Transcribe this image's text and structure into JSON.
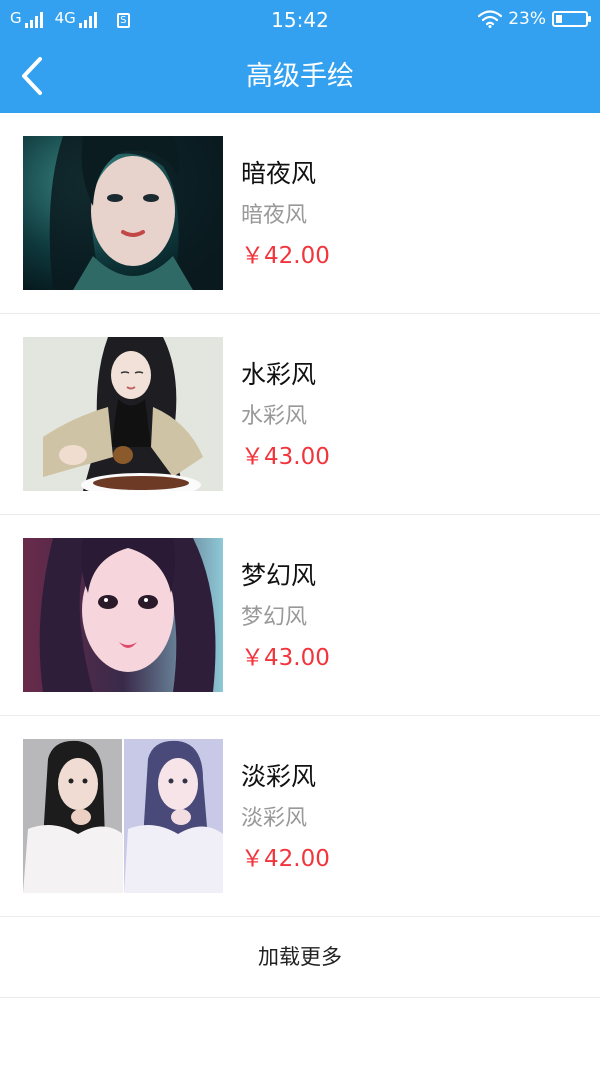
{
  "status_bar": {
    "carrier1": "G",
    "carrier2": "4G",
    "sim_label": "S",
    "time": "15:42",
    "battery_text": "23%",
    "battery_level": 0.23
  },
  "header": {
    "back_icon": "chevron-left-icon",
    "title": "高级手绘"
  },
  "items": [
    {
      "title": "暗夜风",
      "subtitle": "暗夜风",
      "price": "￥42.00"
    },
    {
      "title": "水彩风",
      "subtitle": "水彩风",
      "price": "￥43.00"
    },
    {
      "title": "梦幻风",
      "subtitle": "梦幻风",
      "price": "￥43.00"
    },
    {
      "title": "淡彩风",
      "subtitle": "淡彩风",
      "price": "￥42.00"
    }
  ],
  "load_more": "加载更多",
  "colors": {
    "primary": "#33a1ef",
    "price": "#f2343c",
    "subtitle": "#999999",
    "divider": "#ececec"
  }
}
